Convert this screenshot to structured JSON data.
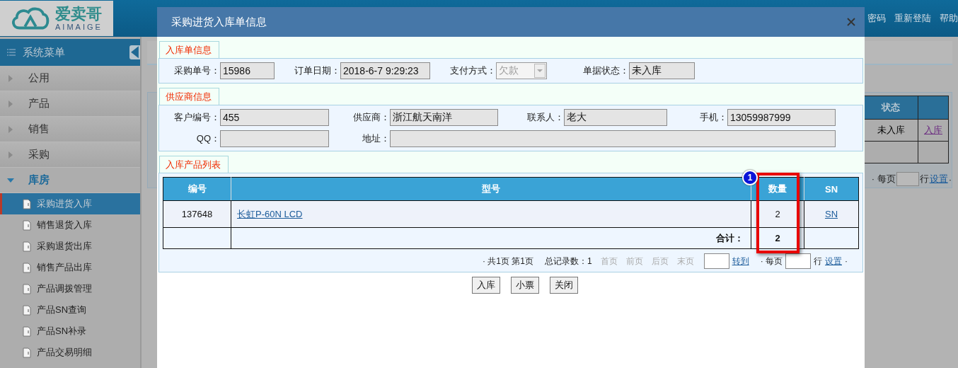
{
  "header": {
    "logo_text": "爱卖哥",
    "logo_subtext": "AIMAIGE",
    "links": [
      "密码",
      "重新登陆",
      "帮助"
    ]
  },
  "sidebar": {
    "title": "系统菜单",
    "items": [
      {
        "label": "公用",
        "expanded": false
      },
      {
        "label": "产品",
        "expanded": false
      },
      {
        "label": "销售",
        "expanded": false
      },
      {
        "label": "采购",
        "expanded": false
      },
      {
        "label": "库房",
        "expanded": true,
        "children": [
          {
            "label": "采购进货入库",
            "selected": true
          },
          {
            "label": "销售退货入库",
            "selected": false
          },
          {
            "label": "采购退货出库",
            "selected": false
          },
          {
            "label": "销售产品出库",
            "selected": false
          },
          {
            "label": "产品调拨管理",
            "selected": false
          },
          {
            "label": "产品SN查询",
            "selected": false
          },
          {
            "label": "产品SN补录",
            "selected": false
          },
          {
            "label": "产品交易明细",
            "selected": false
          }
        ]
      }
    ]
  },
  "background_table": {
    "columns": [
      "状态"
    ],
    "rows": [
      {
        "status": "未入库",
        "action": "入库"
      }
    ],
    "pager": {
      "per_page": "· 每页",
      "rows_label": "行",
      "set_link": "设置",
      "end_mark": "·"
    }
  },
  "dialog": {
    "title": "采购进货入库单信息",
    "sections": [
      {
        "title": "入库单信息",
        "rows": [
          [
            {
              "label": "采购单号：",
              "value": "15986",
              "kind": "text"
            },
            {
              "label": "订单日期：",
              "value": "2018-6-7 9:29:23",
              "kind": "text"
            },
            {
              "label": "支付方式：",
              "value": "欠款",
              "kind": "select",
              "disabled": true
            },
            {
              "label": "单据状态：",
              "value": "未入库",
              "kind": "text"
            }
          ]
        ]
      },
      {
        "title": "供应商信息",
        "rows": [
          [
            {
              "label": "客户编号：",
              "value": "455",
              "kind": "text"
            },
            {
              "label": "供应商：",
              "value": "浙江航天南洋",
              "kind": "text"
            },
            {
              "label": "联系人：",
              "value": "老大",
              "kind": "text"
            },
            {
              "label": "手机：",
              "value": "13059987999",
              "kind": "text"
            }
          ],
          [
            {
              "label": "QQ：",
              "kind": "text"
            },
            {
              "label": "地址：",
              "kind": "text"
            }
          ]
        ]
      }
    ],
    "products": {
      "title": "入库产品列表",
      "columns": [
        "编号",
        "型号",
        "数量",
        "SN"
      ],
      "rows": [
        {
          "code": "137648",
          "model": "长虹P-60N LCD",
          "quantity": "2",
          "sn": "SN"
        }
      ],
      "total": {
        "label": "合计：",
        "quantity": "2"
      },
      "highlight": {
        "badge": "1"
      },
      "pager": {
        "summary": "· 共1页 第1页",
        "total_label": "总记录数：1",
        "nav": [
          {
            "label": "首页",
            "disabled": true
          },
          {
            "label": "前页",
            "disabled": true
          },
          {
            "label": "后页",
            "disabled": true
          },
          {
            "label": "末页",
            "disabled": true
          }
        ],
        "goto": "转到",
        "per_page": "· 每页",
        "rows_label": "行",
        "set_link": "设置",
        "end_mark": "·"
      }
    },
    "buttons": [
      "入库",
      "小票",
      "关闭"
    ]
  }
}
